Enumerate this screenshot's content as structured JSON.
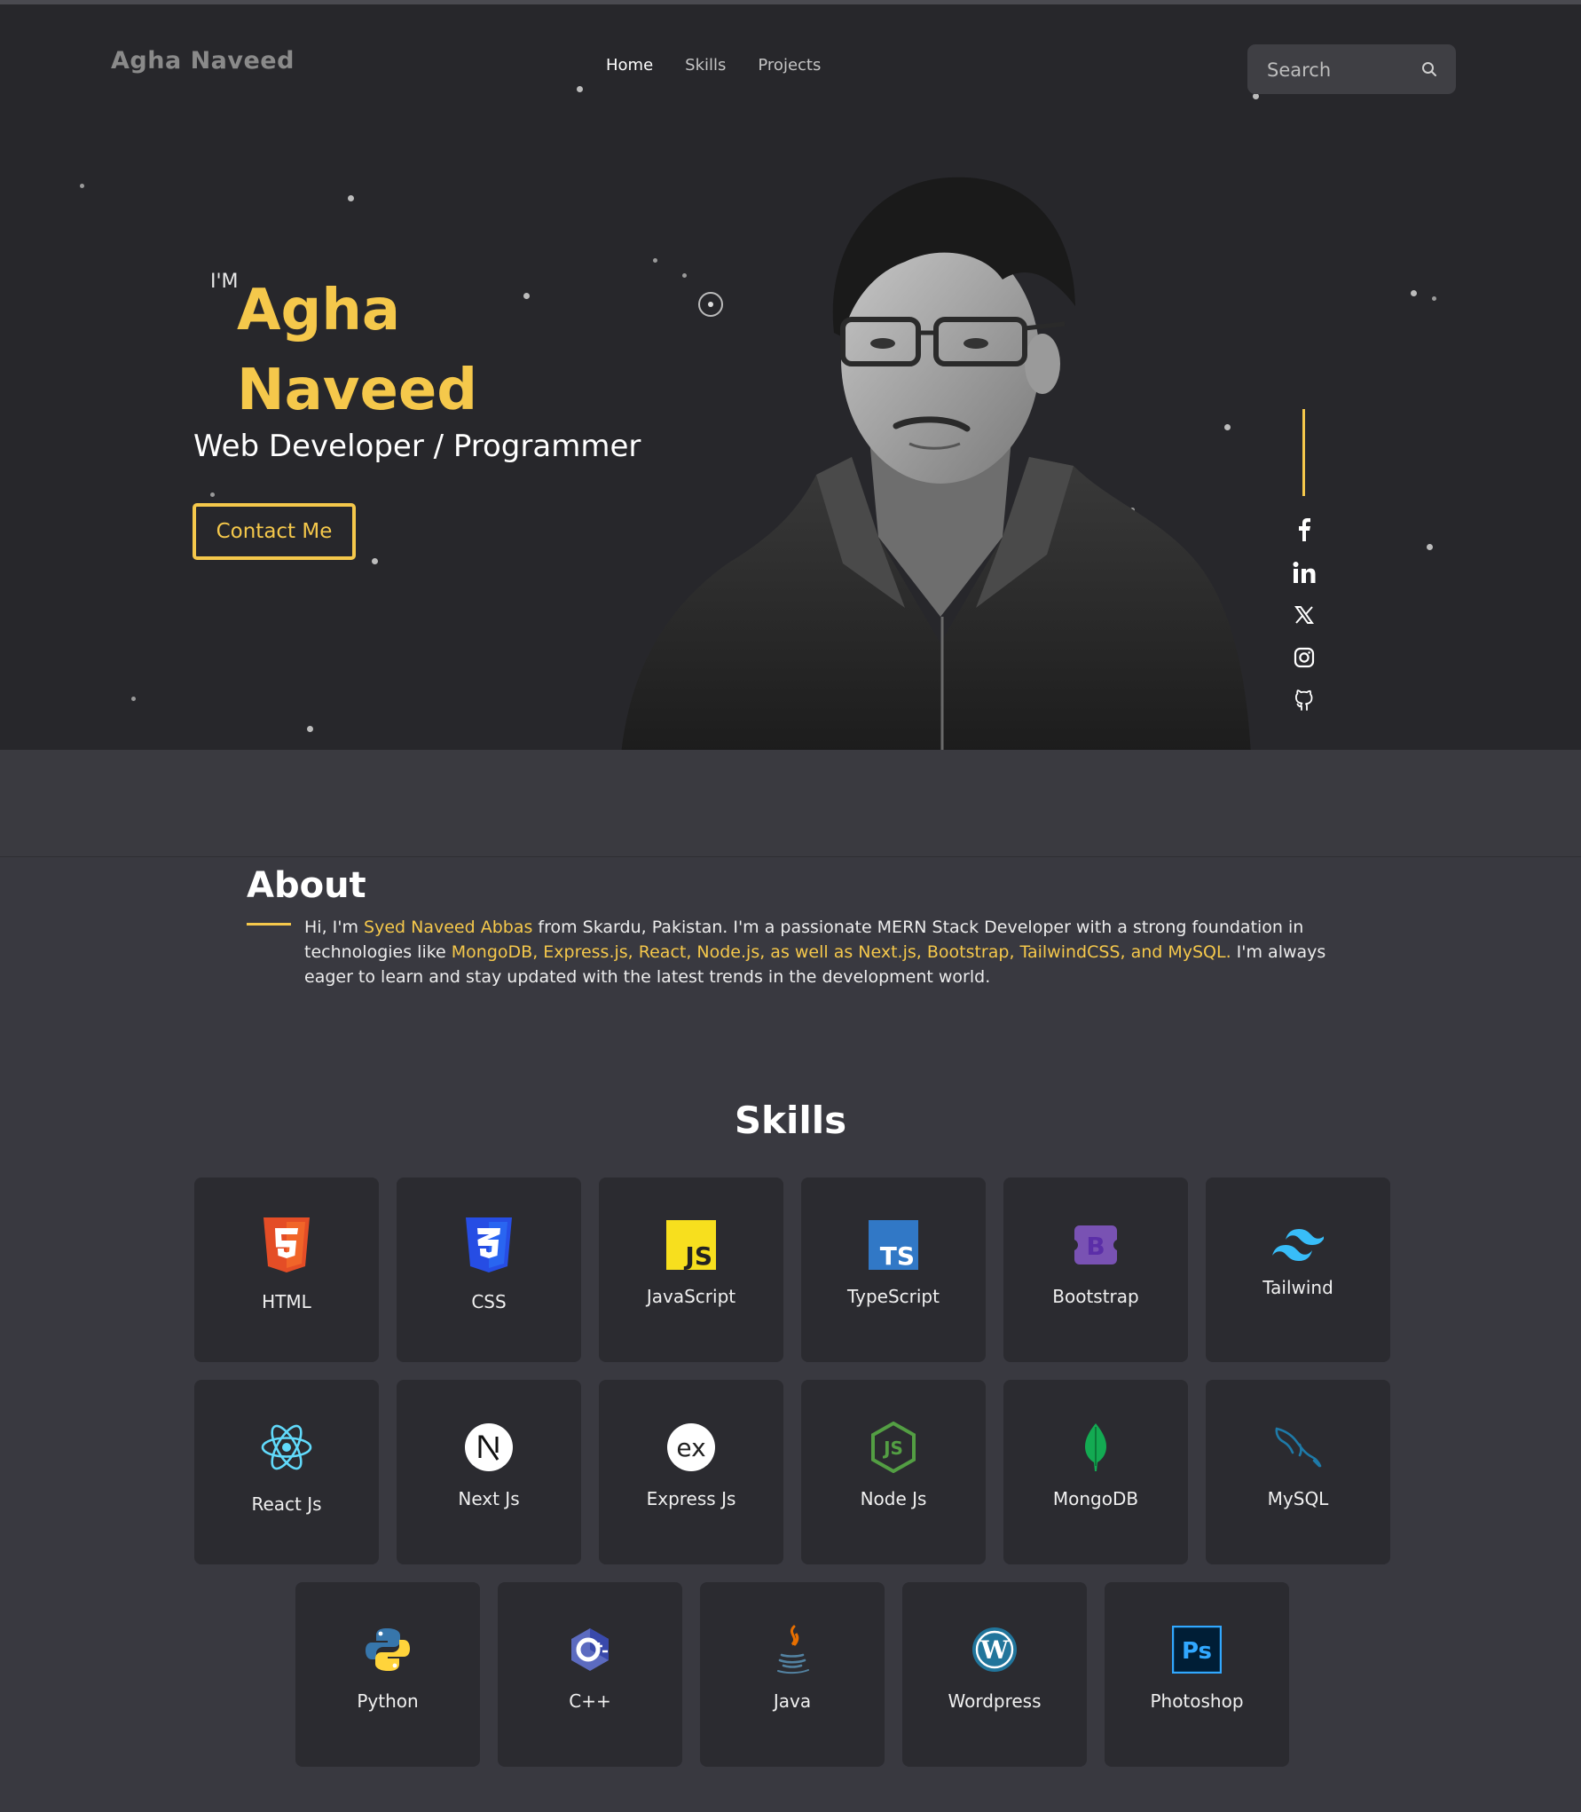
{
  "header": {
    "logo": "Agha Naveed",
    "nav": [
      {
        "label": "Home",
        "active": true
      },
      {
        "label": "Skills",
        "active": false
      },
      {
        "label": "Projects",
        "active": false
      }
    ],
    "search_placeholder": "Search"
  },
  "hero": {
    "intro": "I'M",
    "first_name": "Agha",
    "last_name": "Naveed",
    "role": "Web Developer / Programmer",
    "cta": "Contact Me",
    "social": [
      "facebook-icon",
      "linkedin-icon",
      "x-icon",
      "instagram-icon",
      "github-icon"
    ]
  },
  "about": {
    "title": "About",
    "text_1": "Hi, I'm ",
    "highlight_name": "Syed Naveed Abbas",
    "text_2": " from Skardu, Pakistan. I'm a passionate MERN Stack Developer with a strong foundation in technologies like ",
    "highlight_tech": "MongoDB, Express.js, React, Node.js, as well as Next.js, Bootstrap, TailwindCSS, and MySQL.",
    "text_3": " I'm always eager to learn and stay updated with the latest trends in the development world."
  },
  "skills": {
    "title": "Skills",
    "items": [
      {
        "label": "HTML",
        "icon": "html5-icon"
      },
      {
        "label": "CSS",
        "icon": "css3-icon"
      },
      {
        "label": "JavaScript",
        "icon": "javascript-icon"
      },
      {
        "label": "TypeScript",
        "icon": "typescript-icon"
      },
      {
        "label": "Bootstrap",
        "icon": "bootstrap-icon"
      },
      {
        "label": "Tailwind",
        "icon": "tailwind-icon"
      },
      {
        "label": "React Js",
        "icon": "react-icon"
      },
      {
        "label": "Next Js",
        "icon": "nextjs-icon"
      },
      {
        "label": "Express Js",
        "icon": "express-icon"
      },
      {
        "label": "Node Js",
        "icon": "nodejs-icon"
      },
      {
        "label": "MongoDB",
        "icon": "mongodb-icon"
      },
      {
        "label": "MySQL",
        "icon": "mysql-icon"
      },
      {
        "label": "Python",
        "icon": "python-icon"
      },
      {
        "label": "C++",
        "icon": "cplusplus-icon"
      },
      {
        "label": "Java",
        "icon": "java-icon"
      },
      {
        "label": "Wordpress",
        "icon": "wordpress-icon"
      },
      {
        "label": "Photoshop",
        "icon": "photoshop-icon"
      }
    ]
  },
  "colors": {
    "accent": "#f5c84b",
    "hero_bg": "#27272b",
    "page_bg": "#393940",
    "card_bg": "#2b2b30"
  }
}
